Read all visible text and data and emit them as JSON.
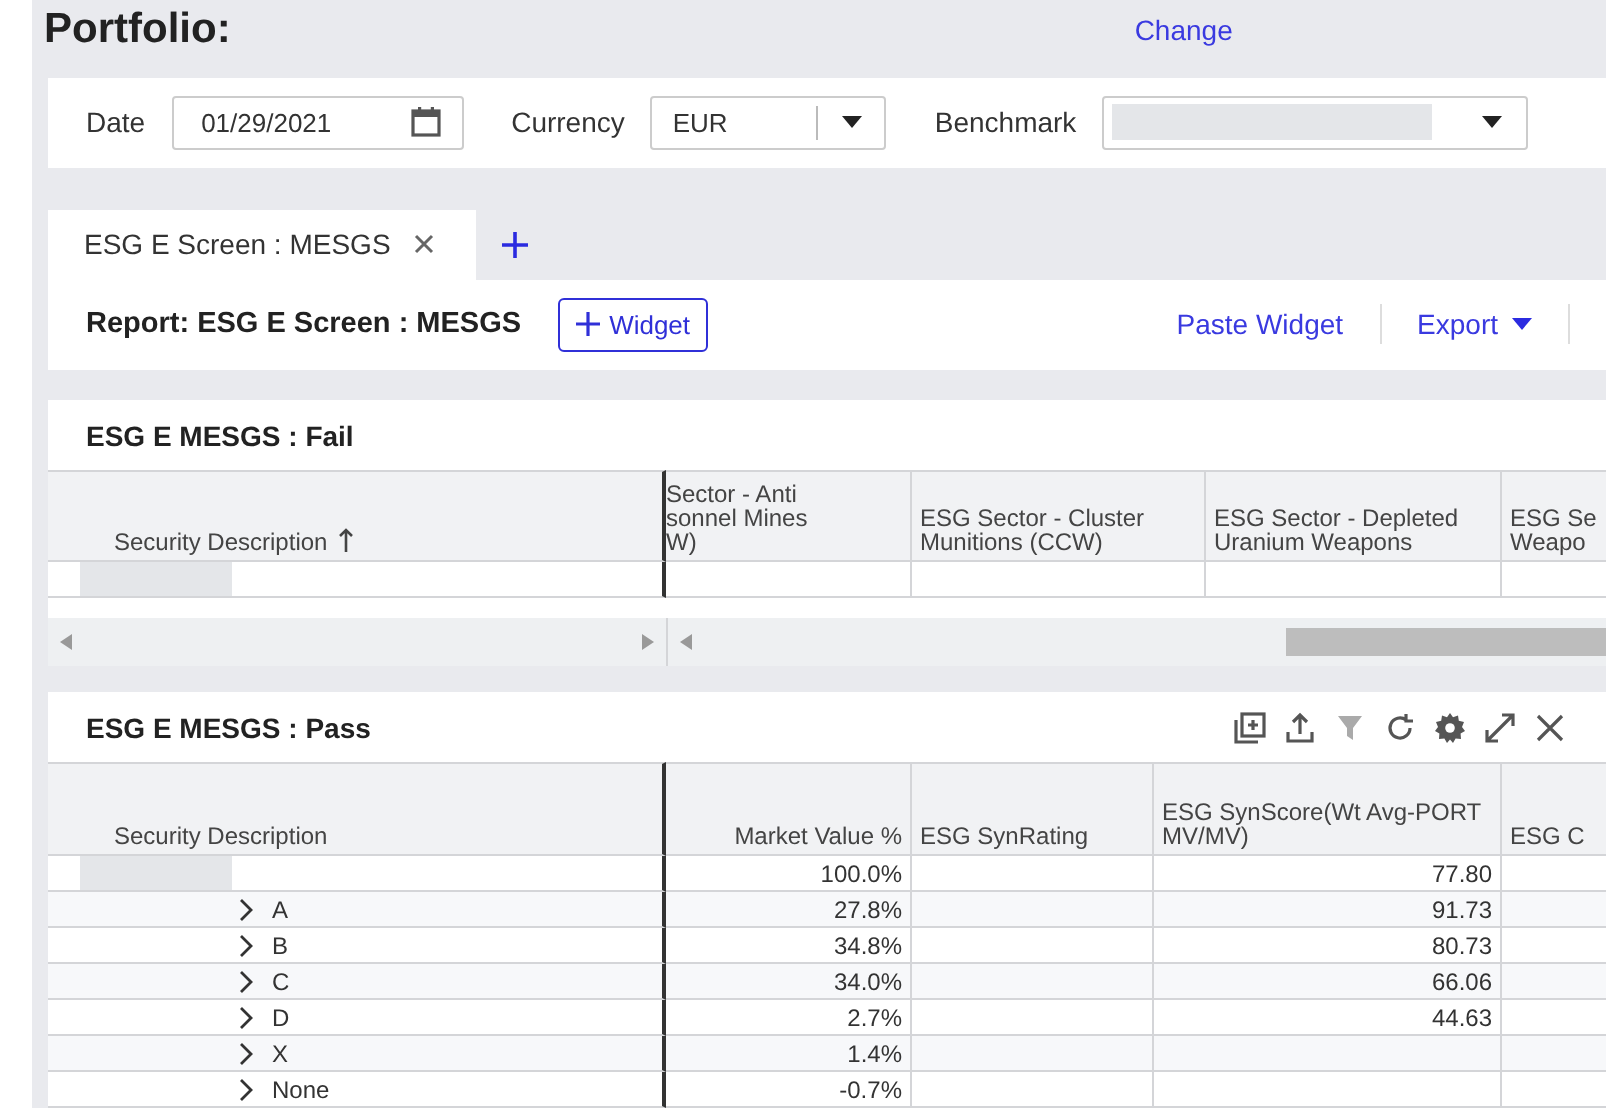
{
  "page": {
    "title": "Portfolio:",
    "change_link": "Change"
  },
  "filters": [
    {
      "kind": "date",
      "label": "Date",
      "value": "01/29/2021"
    },
    {
      "kind": "select",
      "label": "Currency",
      "value": "EUR"
    },
    {
      "kind": "redacted-select",
      "label": "Benchmark"
    }
  ],
  "tabs": [
    {
      "label": "ESG E Screen : MESGS",
      "selected": true
    }
  ],
  "report": {
    "title": "Report: ESG E Screen : MESGS",
    "widget_button": "Widget",
    "paste_link": "Paste Widget",
    "export_menu": "Export"
  },
  "fail_panel": {
    "title": "ESG E MESGS : Fail",
    "columns": [
      {
        "label": "Security Description",
        "sorted": true
      },
      {
        "label": "Sector - Anti\nsonnel Mines\nW)"
      },
      {
        "label": "ESG Sector - Cluster\nMunitions (CCW)"
      },
      {
        "label": "ESG Sector - Depleted\nUranium Weapons"
      },
      {
        "label": "ESG Se\nWeapo"
      }
    ],
    "rows": [
      {
        "kind": "redacted",
        "cells": [
          "",
          "",
          "",
          ""
        ]
      }
    ]
  },
  "pass_panel": {
    "title": "ESG E MESGS : Pass",
    "columns": [
      {
        "label": "Security Description"
      },
      {
        "label": "Market Value %"
      },
      {
        "label": "ESG SynRating"
      },
      {
        "label": "ESG SynScore(Wt Avg-PORT\nMV/MV)"
      },
      {
        "label": "ESG C"
      }
    ],
    "rows": [
      {
        "kind": "redacted",
        "cells": [
          "100.0%",
          "",
          "77.80",
          ""
        ]
      },
      {
        "kind": "group",
        "label": "A",
        "expanded": false,
        "cells": [
          "27.8%",
          "",
          "91.73",
          ""
        ]
      },
      {
        "kind": "group",
        "label": "B",
        "expanded": false,
        "cells": [
          "34.8%",
          "",
          "80.73",
          ""
        ]
      },
      {
        "kind": "group",
        "label": "C",
        "expanded": false,
        "cells": [
          "34.0%",
          "",
          "66.06",
          ""
        ]
      },
      {
        "kind": "group",
        "label": "D",
        "expanded": false,
        "cells": [
          "2.7%",
          "",
          "44.63",
          ""
        ]
      },
      {
        "kind": "group",
        "label": "X",
        "expanded": false,
        "cells": [
          "1.4%",
          "",
          "",
          ""
        ]
      },
      {
        "kind": "group",
        "label": "None",
        "expanded": false,
        "cells": [
          "-0.7%",
          "",
          "",
          ""
        ]
      }
    ]
  }
}
